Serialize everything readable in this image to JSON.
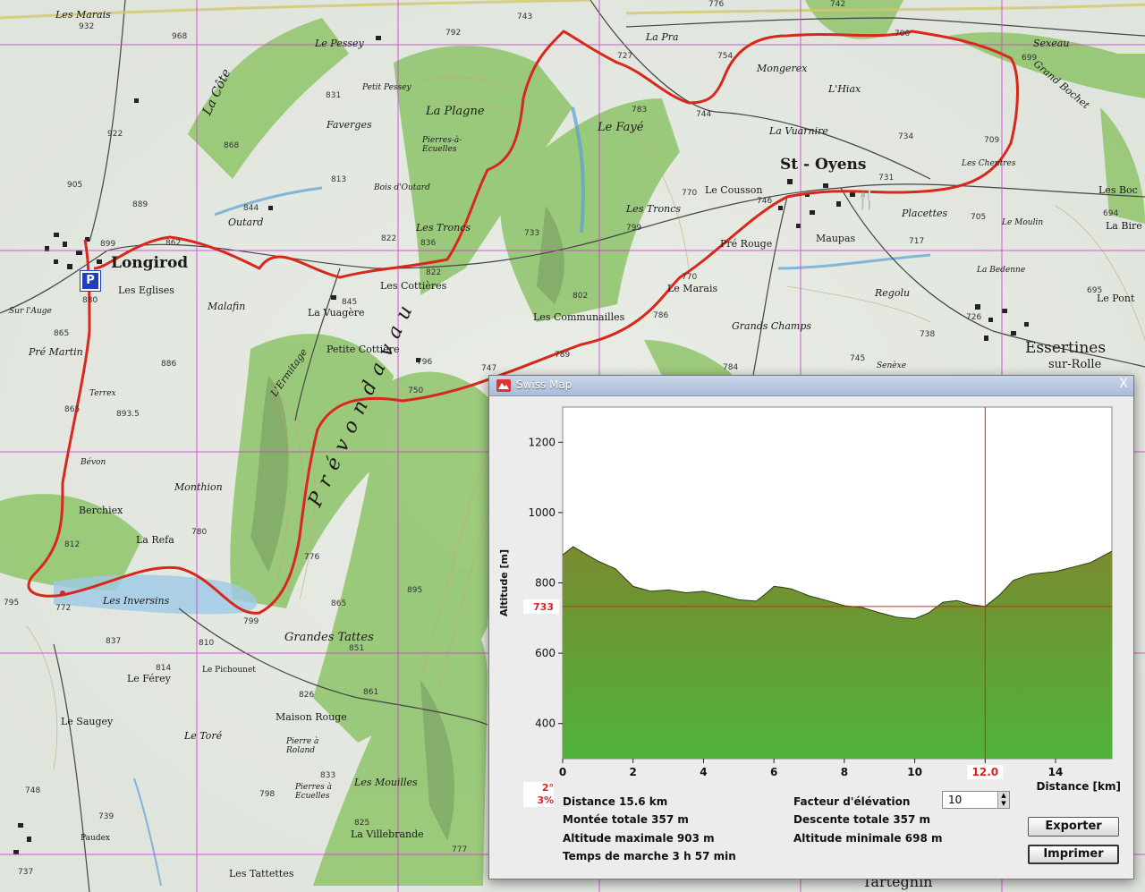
{
  "map": {
    "places": [
      {
        "id": "longirod",
        "label": "Longirod"
      },
      {
        "id": "st-oyens",
        "label": "St - Oyens"
      },
      {
        "id": "essertines",
        "label": "Essertines"
      },
      {
        "id": "sur-rolle",
        "label": "sur-Rolle"
      },
      {
        "id": "les-marais-nw",
        "label": "Les Marais"
      },
      {
        "id": "le-pessey",
        "label": "Le Pessey"
      },
      {
        "id": "petit-pessey",
        "label": "Petit Pessey"
      },
      {
        "id": "favergese",
        "label": "Faverges"
      },
      {
        "id": "la-plagne",
        "label": "La Plagne"
      },
      {
        "id": "pierres-ecuelles",
        "label": "Pierres-à-Ecuelles"
      },
      {
        "id": "le-faye",
        "label": "Le Fayé"
      },
      {
        "id": "la-pra",
        "label": "La Pra"
      },
      {
        "id": "mongerex",
        "label": "Mongerex"
      },
      {
        "id": "l-hiax",
        "label": "L'Hiax"
      },
      {
        "id": "la-vuarnire",
        "label": "La Vuarnire"
      },
      {
        "id": "sexeau",
        "label": "Sexeau"
      },
      {
        "id": "grand-bochet",
        "label": "Grand Bochet"
      },
      {
        "id": "les-chentres",
        "label": "Les Chentres"
      },
      {
        "id": "le-cousson",
        "label": "Le Cousson"
      },
      {
        "id": "les-troncs-1",
        "label": "Les Troncs"
      },
      {
        "id": "les-troncs-2",
        "label": "Les Troncs"
      },
      {
        "id": "bois-d-outard",
        "label": "Bois d'Outard"
      },
      {
        "id": "outard",
        "label": "Outard"
      },
      {
        "id": "placettes",
        "label": "Placettes"
      },
      {
        "id": "le-moulin",
        "label": "Le Moulin"
      },
      {
        "id": "maupas",
        "label": "Maupas"
      },
      {
        "id": "pre-rouge",
        "label": "Pré Rouge"
      },
      {
        "id": "le-marais",
        "label": "Le Marais"
      },
      {
        "id": "regolu",
        "label": "Regolu"
      },
      {
        "id": "la-bedenne",
        "label": "La Bedenne"
      },
      {
        "id": "grands-champs",
        "label": "Grands Champs"
      },
      {
        "id": "les-communailles",
        "label": "Les Communailles"
      },
      {
        "id": "les-cottieres",
        "label": "Les Cottières"
      },
      {
        "id": "la-vuagere",
        "label": "La Vuagère"
      },
      {
        "id": "malafin",
        "label": "Malafin"
      },
      {
        "id": "les-eglises",
        "label": "Les Eglises"
      },
      {
        "id": "sur-l-auge",
        "label": "Sur l'Auge"
      },
      {
        "id": "pre-martin",
        "label": "Pré Martin"
      },
      {
        "id": "terrex",
        "label": "Terrex"
      },
      {
        "id": "petite-cottiere",
        "label": "Petite Cottière"
      },
      {
        "id": "l-ermitage",
        "label": "L'Ermitage"
      },
      {
        "id": "bevon",
        "label": "Bévon"
      },
      {
        "id": "monthion",
        "label": "Monthion"
      },
      {
        "id": "berchiex",
        "label": "Berchiex"
      },
      {
        "id": "la-refa",
        "label": "La Refa"
      },
      {
        "id": "les-inversins",
        "label": "Les Inversins"
      },
      {
        "id": "grandes-tattes",
        "label": "Grandes Tattes"
      },
      {
        "id": "le-pichounet",
        "label": "Le Pichounet"
      },
      {
        "id": "le-ferey",
        "label": "Le Férey"
      },
      {
        "id": "le-saugey",
        "label": "Le Saugey"
      },
      {
        "id": "le-tore",
        "label": "Le Toré"
      },
      {
        "id": "maison-rouge",
        "label": "Maison Rouge"
      },
      {
        "id": "pierre-a-roland",
        "label": "Pierre à Roland"
      },
      {
        "id": "pierres-ecuelles-2",
        "label": "Pierres à Ecuelles"
      },
      {
        "id": "les-mouilles",
        "label": "Les Mouilles"
      },
      {
        "id": "la-villebrande",
        "label": "La Villebrande"
      },
      {
        "id": "paudex",
        "label": "Paudex"
      },
      {
        "id": "les-tattettes",
        "label": "Les Tattettes"
      },
      {
        "id": "pre-vondavau",
        "label": "Prévondavau"
      },
      {
        "id": "la-cote",
        "label": "La Côte"
      },
      {
        "id": "les-bocs",
        "label": "Les Boc"
      },
      {
        "id": "la-bire",
        "label": "La Bire"
      },
      {
        "id": "le-pont",
        "label": "Le Pont"
      },
      {
        "id": "senexe",
        "label": "Senèxe"
      },
      {
        "id": "tartegnin",
        "label": "Tartegnin"
      }
    ],
    "spot_heights": [
      "932",
      "968",
      "922",
      "905",
      "899",
      "889",
      "844",
      "862",
      "845",
      "880",
      "865",
      "886",
      "893.5",
      "865",
      "812",
      "780",
      "795",
      "772",
      "837",
      "814",
      "810",
      "799",
      "776",
      "865",
      "851",
      "895",
      "861",
      "826",
      "833",
      "825",
      "823",
      "777",
      "798",
      "748",
      "739",
      "737",
      "792",
      "743",
      "727",
      "754",
      "744",
      "783",
      "776",
      "742",
      "700",
      "699",
      "709",
      "734",
      "731",
      "770",
      "746",
      "717",
      "705",
      "694",
      "695",
      "726",
      "738",
      "745",
      "784",
      "789",
      "786",
      "770",
      "802",
      "796",
      "750",
      "747",
      "733",
      "799",
      "822",
      "836",
      "831",
      "868",
      "813",
      "822"
    ],
    "parking_label": "P",
    "route_color": "#d8281c"
  },
  "window": {
    "title": "Swiss Map",
    "close_label": "X"
  },
  "chart_data": {
    "type": "area",
    "title": "",
    "xlabel": "Distance [km]",
    "ylabel": "Altitude [m]",
    "xlim": [
      0,
      15.6
    ],
    "ylim": [
      300,
      1300
    ],
    "xticks": [
      0,
      2,
      4,
      6,
      8,
      10,
      12,
      14
    ],
    "yticks": [
      400,
      600,
      800,
      1000,
      1200
    ],
    "cursor": {
      "x": 12.0,
      "y": 733,
      "x_label": "12.0",
      "y_label": "733"
    },
    "series": [
      {
        "x": [
          0,
          0.3,
          0.6,
          1.0,
          1.5,
          2.0,
          2.5,
          3.0,
          3.5,
          4.0,
          4.5,
          5.0,
          5.5,
          5.8,
          6.0,
          6.2,
          6.5,
          7.0,
          7.5,
          8.0,
          8.5,
          9.0,
          9.5,
          10.0,
          10.4,
          10.8,
          11.2,
          11.6,
          12.0,
          12.4,
          12.8,
          13.3,
          14.0,
          14.5,
          15.0,
          15.6
        ],
        "y": [
          880,
          903,
          885,
          862,
          840,
          790,
          776,
          780,
          772,
          776,
          765,
          752,
          748,
          772,
          790,
          788,
          783,
          763,
          750,
          735,
          730,
          715,
          702,
          698,
          715,
          745,
          750,
          738,
          733,
          765,
          807,
          825,
          832,
          845,
          858,
          890
        ]
      }
    ],
    "colors": {
      "fill_top": "#7a8a30",
      "fill_bottom": "#4fb33a",
      "line": "#2f3a14",
      "cursor": "#cc2a10"
    }
  },
  "info": {
    "slope_top": "2°",
    "slope_bottom": "3%",
    "distance": "Distance  15.6 km",
    "ascent": "Montée totale  357 m",
    "max_alt": "Altitude maximale  903 m",
    "walk_time": "Temps de marche    3 h 57 min",
    "elev_factor_label": "Facteur d'élévation",
    "elev_factor_value": "10",
    "descent": "Descente totale  357 m",
    "min_alt": "Altitude minimale  698 m"
  },
  "buttons": {
    "export": "Exporter",
    "print": "Imprimer"
  }
}
